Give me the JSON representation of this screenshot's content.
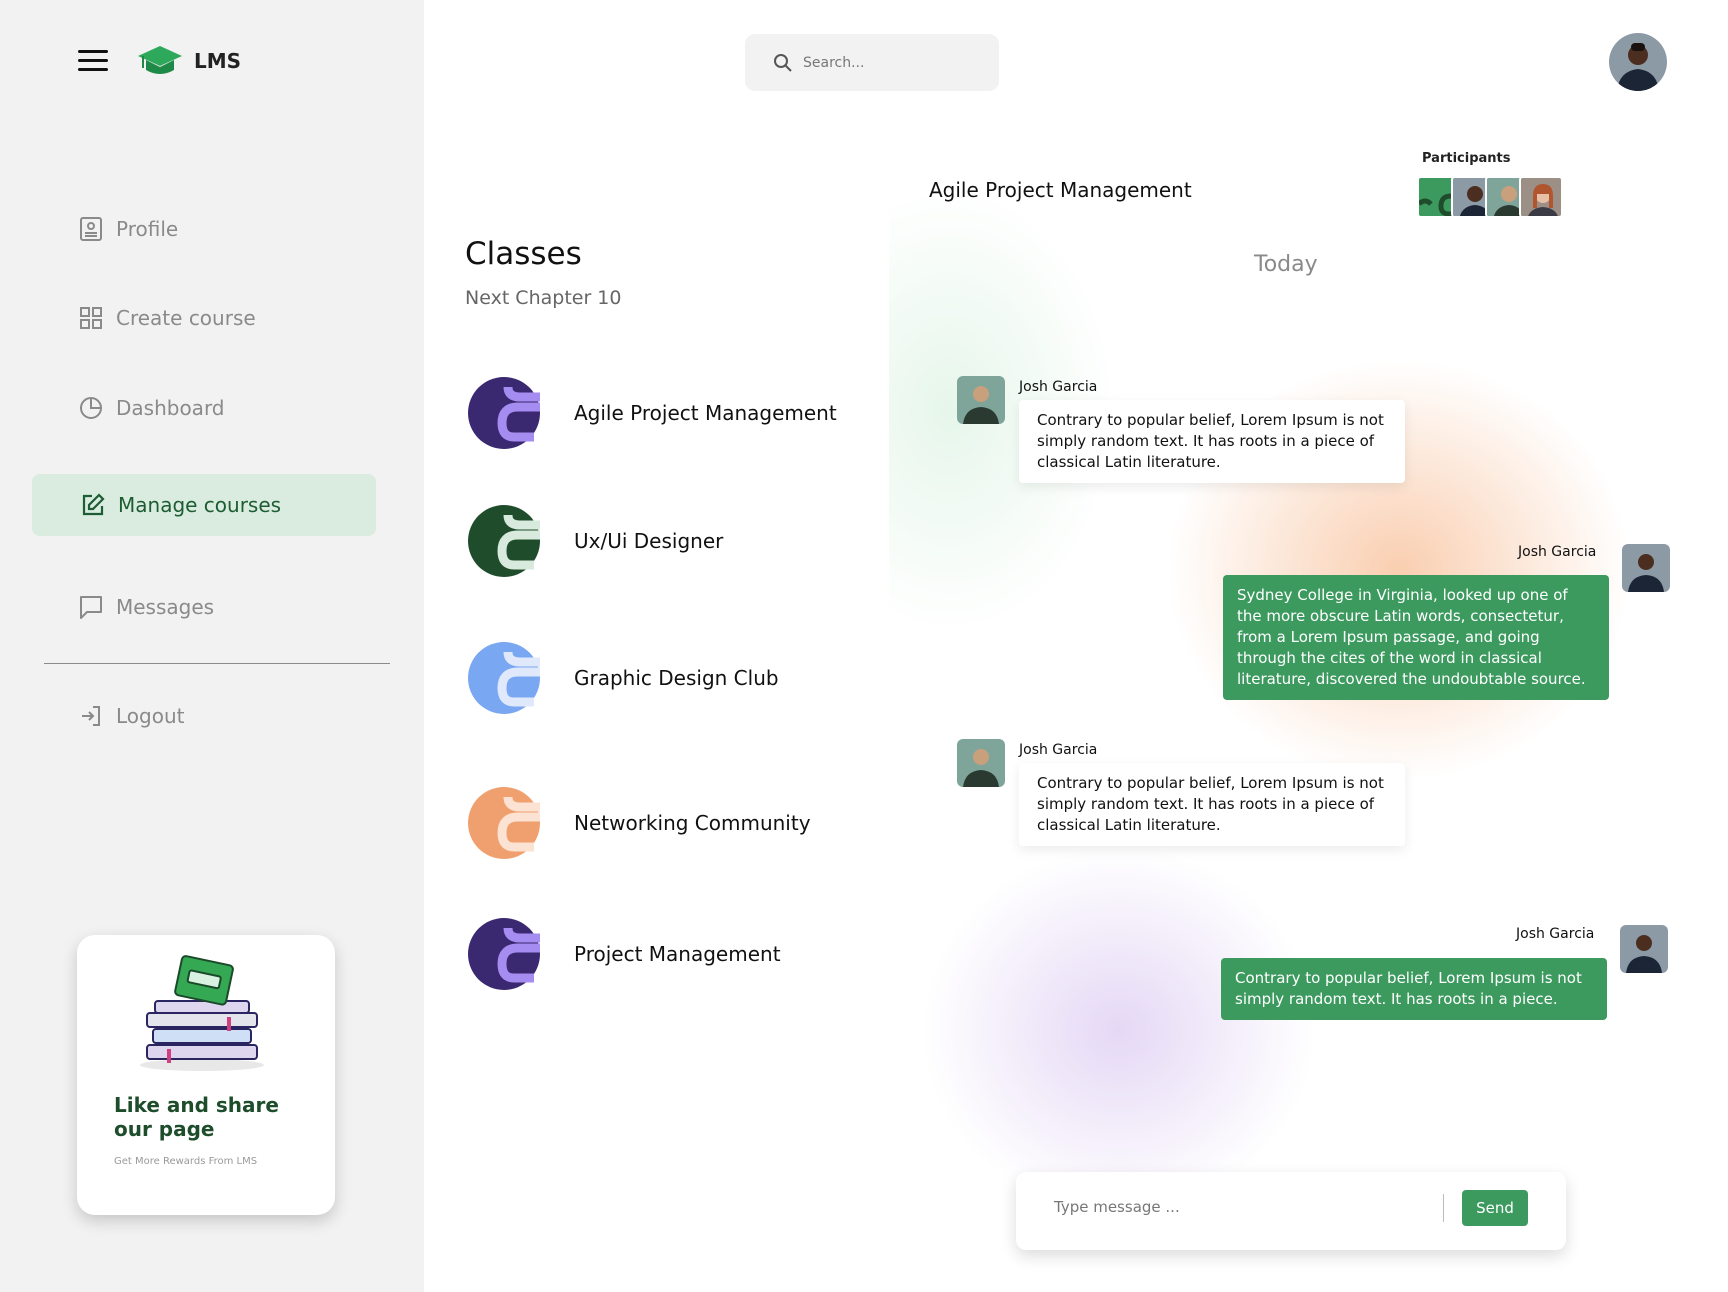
{
  "app": {
    "logo_text": "LMS"
  },
  "search": {
    "placeholder": "Search..."
  },
  "sidebar": {
    "items": [
      {
        "label": "Profile",
        "icon": "profile-icon"
      },
      {
        "label": "Create course",
        "icon": "grid-icon"
      },
      {
        "label": "Dashboard",
        "icon": "pie-chart-icon"
      },
      {
        "label": "Manage courses",
        "icon": "edit-icon",
        "active": true
      },
      {
        "label": "Messages",
        "icon": "message-icon"
      },
      {
        "label": "Logout",
        "icon": "logout-icon"
      }
    ],
    "promo": {
      "title": "Like and share our page",
      "subtitle": "Get More Rewards From LMS"
    }
  },
  "classes": {
    "title": "Classes",
    "subtitle": "Next Chapter 10",
    "items": [
      {
        "name": "Agile Project Management",
        "color": "#3a2870"
      },
      {
        "name": "Ux/Ui Designer",
        "color": "#1f4d2c"
      },
      {
        "name": "Graphic Design Club",
        "color": "#7aa7f2"
      },
      {
        "name": "Networking Community",
        "color": "#f0a06e"
      },
      {
        "name": "Project Management",
        "color": "#3a2870"
      }
    ]
  },
  "chat": {
    "title": "Agile Project Management",
    "participants_label": "Participants",
    "day_label": "Today",
    "messages": [
      {
        "sender": "Josh Garcia",
        "direction": "in",
        "text": "Contrary to popular belief, Lorem Ipsum is not simply random text. It has roots in a piece of classical Latin literature."
      },
      {
        "sender": "Josh Garcia",
        "direction": "out",
        "text": "Sydney College in Virginia, looked up one of the more obscure Latin words, consectetur, from a Lorem Ipsum passage, and going through the cites of the word in classical literature, discovered the undoubtable source."
      },
      {
        "sender": "Josh Garcia",
        "direction": "in",
        "text": "Contrary to popular belief, Lorem Ipsum is not simply random text. It has roots in a piece of classical Latin literature."
      },
      {
        "sender": "Josh Garcia",
        "direction": "out",
        "text": "Contrary to popular belief, Lorem Ipsum is not simply random text. It has roots in a piece."
      }
    ],
    "composer": {
      "placeholder": "Type message ...",
      "send_label": "Send"
    }
  },
  "colors": {
    "accent": "#3c9a5f",
    "active_bg": "#d9ecdf",
    "active_text": "#1e5c33"
  }
}
